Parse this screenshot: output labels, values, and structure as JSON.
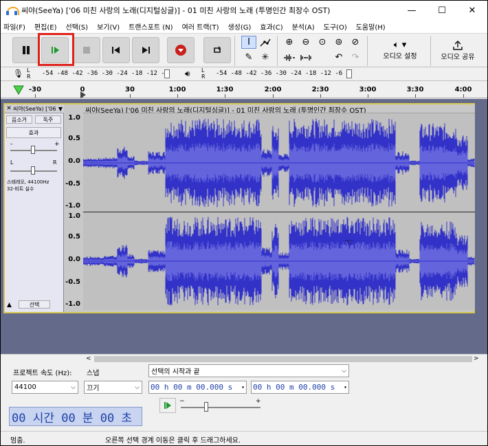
{
  "window": {
    "title": "씨야(SeeYa) ['06 미친 사랑의 노래(디지털싱글)] - 01 미친 사랑의 노래 (투명인간 최장수 OST)",
    "minimize": "—",
    "maximize": "☐",
    "close": "✕"
  },
  "menu": [
    "파일(F)",
    "편집(E)",
    "선택(S)",
    "보기(V)",
    "트랜스포트 (N)",
    "여러 트랙(T)",
    "생성(G)",
    "효과(C)",
    "분석(A)",
    "도구(O)",
    "도움말(H)"
  ],
  "toolbar": {
    "audio_setup": "오디오 설정",
    "audio_share": "오디오 공유",
    "audio_setup_caret": "▾"
  },
  "meters": {
    "rec_lr": "L\nR",
    "rec_scale": "-54 -48 -42 -36 -30 -24 -18 -12 -6",
    "play_scale": "-54 -48 -42 -36 -30 -24 -18 -12 -6"
  },
  "ruler": [
    "-30",
    "0",
    "30",
    "1:00",
    "1:30",
    "2:00",
    "2:30",
    "3:00",
    "3:30",
    "4:00"
  ],
  "track": {
    "name": "씨야(SeeYa) ['06",
    "mute": "음소거",
    "solo": "독주",
    "effects": "효과",
    "gain_minus": "-",
    "gain_plus": "+",
    "pan_l": "L",
    "pan_r": "R",
    "info": "스테레오, 44100Hz\n32-비트 실수",
    "select": "선택",
    "clip_title": "씨야(SeeYa) ['06 미친 사랑의 노래(디지털싱글)] - 01 미친 사랑의 노래 (투명인간 최장수 OST)",
    "scale": [
      "1.0",
      "0.5",
      "0.0",
      "-0.5",
      "-1.0"
    ]
  },
  "bottom": {
    "project_rate_label": "프로젝트 속도 (Hz):",
    "snap_label": "스냅",
    "selection_label": "선택의 시작과 끝",
    "rate_value": "44100",
    "snap_value": "끄기",
    "sel_start": "00 h 00 m 00.000 s",
    "sel_end": "00 h 00 m 00.000 s",
    "time_display": "00 시간 00 분 00 초"
  },
  "status": {
    "state": "멈춤.",
    "hint": "오른쪽 선택 경계 이동은 클릭 후 드래그하세요."
  },
  "colors": {
    "wave": "#3232c8",
    "wave_light": "#6464dc",
    "record": "#c8201c",
    "play": "#1a9a2a",
    "highlight": "#e0201a"
  }
}
